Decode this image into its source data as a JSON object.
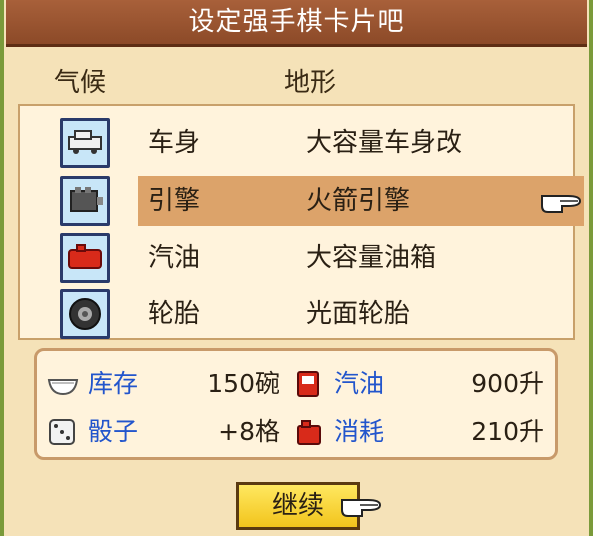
{
  "title": "设定强手棋卡片吧",
  "columns": {
    "weather": "气候",
    "terrain": "地形"
  },
  "rows": [
    {
      "label": "车身",
      "value": "大容量车身改",
      "icon": "car-body-icon",
      "selected": false
    },
    {
      "label": "引擎",
      "value": "火箭引擎",
      "icon": "engine-icon",
      "selected": true
    },
    {
      "label": "汽油",
      "value": "大容量油箱",
      "icon": "fuel-tank-icon",
      "selected": false
    },
    {
      "label": "轮胎",
      "value": "光面轮胎",
      "icon": "tire-icon",
      "selected": false
    }
  ],
  "stats": {
    "stock": {
      "label": "库存",
      "value": "150碗",
      "icon": "bowl-icon"
    },
    "fuel": {
      "label": "汽油",
      "value": "900升",
      "icon": "fuel-pump-icon"
    },
    "dice": {
      "label": "骰子",
      "value": "+8格",
      "icon": "dice-icon"
    },
    "consumption": {
      "label": "消耗",
      "value": "210升",
      "icon": "fuel-can-icon"
    }
  },
  "continue_label": "继续",
  "colors": {
    "title_bar": "#9a5430",
    "highlight": "#dca36a",
    "stat_label": "#2255cc",
    "button": "#f5d030"
  }
}
